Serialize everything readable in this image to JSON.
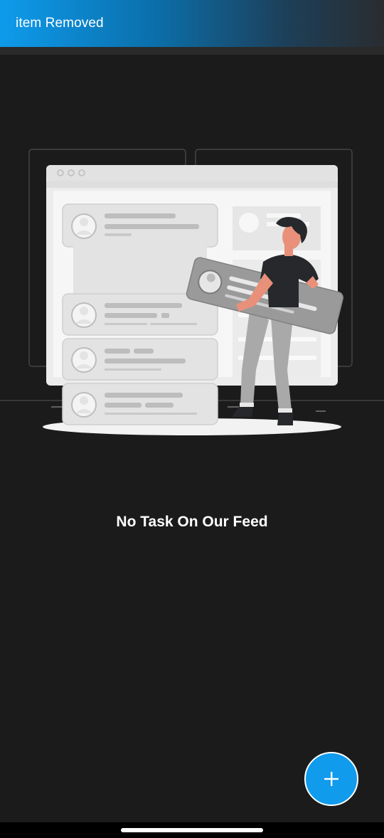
{
  "snackbar": {
    "message": "item Removed"
  },
  "empty_state": {
    "message": "No Task On Our Feed",
    "illustration": "person-carrying-task-cards-illustration"
  },
  "fab": {
    "icon": "plus-icon",
    "color": "#109bec"
  },
  "colors": {
    "background": "#1b1b1b",
    "accent": "#109bec"
  }
}
